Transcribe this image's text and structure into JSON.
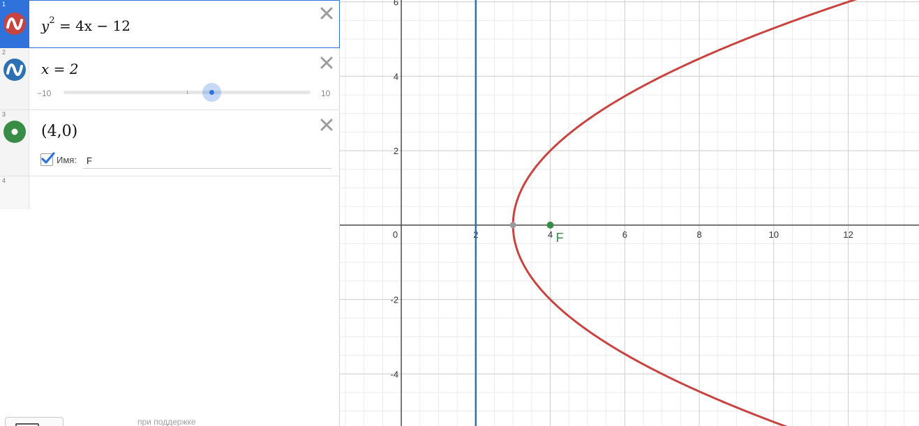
{
  "expressions": [
    {
      "number": "1",
      "latex_parts": {
        "var": "y",
        "exp": "2",
        "rhs": "= 4x − 12"
      },
      "color": "#c74440",
      "icon": "parabola-wave-icon",
      "active": true
    },
    {
      "number": "2",
      "latex": "x = 2",
      "color": "#2d70b3",
      "icon": "line-wave-icon",
      "slider": {
        "min_label": "−10",
        "max_label": "10",
        "value": 2,
        "min": -10,
        "max": 10
      }
    },
    {
      "number": "3",
      "latex": "(4,0)",
      "color": "#388c46",
      "icon": "point-icon",
      "label": {
        "checked": true,
        "caption": "Имя:",
        "value": "F"
      }
    },
    {
      "number": "4"
    }
  ],
  "footer": {
    "text": "при поддержке"
  },
  "graph": {
    "x_range": [
      -1.65,
      13.9
    ],
    "y_range": [
      -5.4,
      6.05
    ],
    "major_step": 2,
    "minor_step": 0.5,
    "x_tick_labels": [
      "2",
      "4",
      "6",
      "8",
      "10",
      "12"
    ],
    "y_tick_labels": [
      "6",
      "4",
      "2",
      "-2",
      "-4"
    ],
    "origin_label": "0",
    "parabola": {
      "equation": "y^2 = 4x - 12",
      "vertex_x": 3,
      "color": "#c74440"
    },
    "vertical_line": {
      "x": 2,
      "color": "#2d70b3"
    },
    "vertex_point": {
      "x": 3,
      "y": 0,
      "color": "#999999"
    },
    "focus_point": {
      "x": 4,
      "y": 0,
      "label": "F",
      "color": "#388c46"
    },
    "axis_color": "#4a4a4a",
    "major_grid_color": "#cccccc",
    "minor_grid_color": "#ececec"
  }
}
